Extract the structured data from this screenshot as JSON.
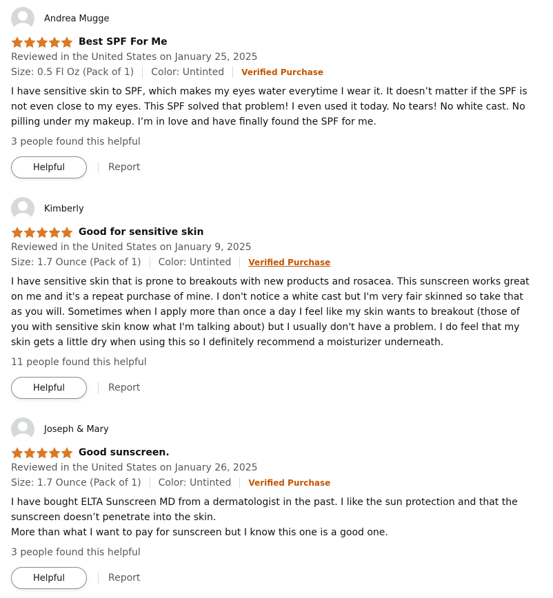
{
  "colors": {
    "star": "#de7921",
    "verified": "#c45500",
    "muted_text": "#565959",
    "avatar_bg": "#d5d9d9"
  },
  "reviews": [
    {
      "profile_name": "Andrea Mugge",
      "rating": 5,
      "title": "Best SPF For Me",
      "date": "Reviewed in the United States on January 25, 2025",
      "size": "Size: 0.5 Fl Oz (Pack of 1)",
      "color": "Color: Untinted",
      "verified": "Verified Purchase",
      "body": [
        "I have sensitive skin to SPF, which makes my eyes water everytime I wear it. It doesn’t matter if the SPF is not even close to my eyes. This SPF solved that problem! I even used it today. No tears! No white cast. No pilling under my makeup. I’m in love and have finally found the SPF for me."
      ],
      "helpful_count": "3 people found this helpful",
      "helpful_label": "Helpful",
      "report_label": "Report"
    },
    {
      "profile_name": "Kimberly",
      "rating": 5,
      "title": "Good for sensitive skin",
      "date": "Reviewed in the United States on January 9, 2025",
      "size": "Size: 1.7 Ounce (Pack of 1)",
      "color": "Color: Untinted",
      "verified": "Verified Purchase",
      "body": [
        "I have sensitive skin that is prone to breakouts with new products and rosacea. This sunscreen works great on me and it's a repeat purchase of mine. I don't notice a white cast but I'm very fair skinned so take that as you will. Sometimes when I apply more than once a day I feel like my skin wants to breakout (those of you with sensitive skin know what I'm talking about) but I usually don't have a problem. I do feel that my skin gets a little dry when using this so I definitely recommend a moisturizer underneath."
      ],
      "helpful_count": "11 people found this helpful",
      "helpful_label": "Helpful",
      "report_label": "Report"
    },
    {
      "profile_name": "Joseph & Mary",
      "rating": 5,
      "title": "Good sunscreen.",
      "date": "Reviewed in the United States on January 26, 2025",
      "size": "Size: 1.7 Ounce (Pack of 1)",
      "color": "Color: Untinted",
      "verified": "Verified Purchase",
      "body": [
        "I have bought ELTA Sunscreen MD from a dermatologist in the past. I like the sun protection and that the sunscreen doesn’t penetrate into the skin.",
        "More than what I want to pay for sunscreen but I know this one is a good one."
      ],
      "helpful_count": "3 people found this helpful",
      "helpful_label": "Helpful",
      "report_label": "Report"
    }
  ]
}
